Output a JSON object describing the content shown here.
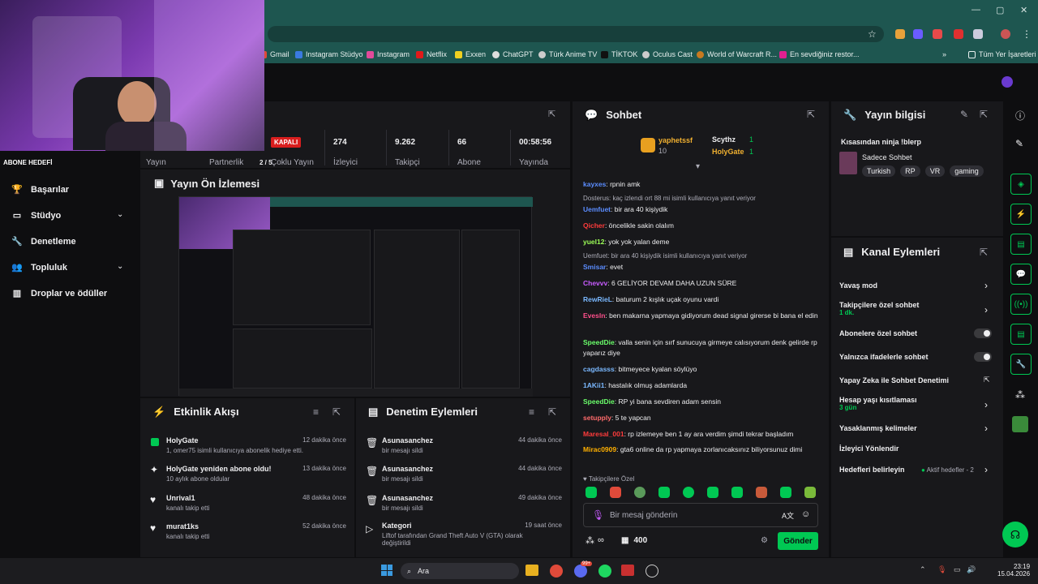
{
  "browser": {
    "bookmarks": [
      "Gmail",
      "Instagram Stüdyo",
      "Instagram",
      "Netflix",
      "Exxen",
      "ChatGPT",
      "Türk Anime TV",
      "TİKTOK",
      "Oculus Cast",
      "World of Warcraft R...",
      "En sevdiğiniz restor...",
      "»",
      "Tüm Yer İşaretleri"
    ],
    "win_min": "—",
    "win_max": "▢",
    "win_close": "✕"
  },
  "webcam": {
    "overlay": "ABONE HEDEFİ",
    "progress": 0.75
  },
  "stats": {
    "yayin": "Yayın",
    "partnerlik": "Partnerlik",
    "partnerlik_val": "2 / 5",
    "coklu": "Çoklu Yayın",
    "kapali": "KAPALI",
    "izleyici_val": "274",
    "izleyici": "İzleyici",
    "takipci_val": "9.262",
    "takipci": "Takipçi",
    "abone_val": "66",
    "abone": "Abone",
    "sure_val": "00:58:56",
    "sure": "Yayında"
  },
  "sidebar": {
    "items": [
      {
        "label": "Başarılar",
        "icon": "trophy-icon"
      },
      {
        "label": "Stüdyo",
        "icon": "studio-icon"
      },
      {
        "label": "Denetleme",
        "icon": "wrench-icon"
      },
      {
        "label": "Topluluk",
        "icon": "community-icon"
      },
      {
        "label": "Droplar ve ödüller",
        "icon": "drops-icon"
      }
    ]
  },
  "preview": {
    "title": "Yayın Ön İzlemesi"
  },
  "activity": {
    "title": "Etkinlik Akışı",
    "events": [
      {
        "title": "HolyGate",
        "sub": "1, omer75 isimli kullanıcıya abonelik hediye etti.",
        "time": "12 dakika önce"
      },
      {
        "title": "HolyGate yeniden abone oldu!",
        "sub": "10 aylık abone oldular",
        "time": "13 dakika önce"
      },
      {
        "title": "Unrival1",
        "sub": "kanalı takip etti",
        "time": "48 dakika önce"
      },
      {
        "title": "murat1ks",
        "sub": "kanalı takip etti",
        "time": "52 dakika önce"
      }
    ]
  },
  "moderation": {
    "title": "Denetim Eylemleri",
    "events": [
      {
        "title": "Asunasanchez",
        "sub": "bir mesajı sildi",
        "time": "44 dakika önce"
      },
      {
        "title": "Asunasanchez",
        "sub": "bir mesajı sildi",
        "time": "44 dakika önce"
      },
      {
        "title": "Asunasanchez",
        "sub": "bir mesajı sildi",
        "time": "49 dakika önce"
      },
      {
        "title": "Kategori",
        "sub": "Liftof tarafından Grand Theft Auto V (GTA) olarak değiştirildi",
        "time": "19 saat önce"
      }
    ]
  },
  "chat": {
    "title": "Sohbet",
    "leader1": "yaphetssf",
    "leader1_count": "10",
    "leader2": "Scythz",
    "leader2_count": "1",
    "leader3": "HolyGate",
    "leader3_count": "1",
    "messages": [
      {
        "user": "kayxes",
        "color": "#5b8dff",
        "text": ": rpnin amk"
      },
      {
        "reply": "Dosterus: kaç izlendi ort 88 mi isimli kullanıcıya yanıt veriyor"
      },
      {
        "user": "Uemfuet",
        "color": "#5b8dff",
        "text": ": bir ara 40 kişiydik"
      },
      {
        "user": "Qicher",
        "color": "#ff3b3b",
        "text": ": öncelikle sakin olalım"
      },
      {
        "user": "yuel12",
        "color": "#9cff57",
        "text": ": yok yok yalan deme"
      },
      {
        "reply": "Uemfuet: bir ara 40 kişiydik isimli kullanıcıya yanıt veriyor"
      },
      {
        "user": "Smisar",
        "color": "#5b8dff",
        "text": ": evet"
      },
      {
        "user": "Chevvv",
        "color": "#c85cff",
        "text": ": 6 GELİYOR DEVAM DAHA UZUN SÜRE"
      },
      {
        "user": "RewRieL",
        "color": "#7ab8ff",
        "text": ": baturum 2 kışlık uçak oyunu vardi"
      },
      {
        "user": "Evesln",
        "color": "#ff4f8b",
        "text": ": ben makarna yapmaya gidiyorum dead signal girerse bi bana el edin"
      },
      {
        "user": "SpeedDie",
        "color": "#6bff6b",
        "text": ": valla senin için sırf sunucuya girmeye calısıyorum denk gelirde rp yaparız diye"
      },
      {
        "user": "cagdasss",
        "color": "#7ab8ff",
        "text": ": bitmeyece kyalan söylüyo"
      },
      {
        "user": "1AKii1",
        "color": "#7ab8ff",
        "text": ": hastalık olmuş adamlarda"
      },
      {
        "user": "SpeedDie",
        "color": "#6bff6b",
        "text": ": RP yi bana sevdiren adam sensin"
      },
      {
        "user": "setupply",
        "color": "#ff6b6b",
        "text": ": 5 te yapcan"
      },
      {
        "user": "Maresal_001",
        "color": "#ff3b3b",
        "text": ": rp izlemeye ben 1 ay ara verdim şimdi tekrar başladım"
      },
      {
        "user": "Mirac0909",
        "color": "#ffb000",
        "text": ": gta6 online da rp yapmaya zorlanıcaksınız biliyorsunuz dimi"
      }
    ],
    "follower_only": "Takipçilere Özel",
    "placeholder": "Bir mesaj gönderin",
    "points": "400",
    "infinity": "∞",
    "send": "Gönder"
  },
  "streaminfo": {
    "title": "Yayın bilgisi",
    "stream_title": "Kısasından ninja !blerp",
    "category": "Sadece Sohbet",
    "tags": [
      "Turkish",
      "RP",
      "VR",
      "gaming"
    ]
  },
  "channel": {
    "title": "Kanal Eylemleri",
    "rows": [
      {
        "label": "Yavaş mod",
        "sub": ""
      },
      {
        "label": "Takipçilere özel sohbet",
        "sub": "1 dk."
      },
      {
        "label": "Abonelere özel sohbet",
        "sub": ""
      },
      {
        "label": "Yalnızca ifadelerle sohbet",
        "sub": ""
      },
      {
        "label": "Yapay Zeka ile Sohbet Denetimi",
        "sub": ""
      },
      {
        "label": "Hesap yaşı kısıtlaması",
        "sub": "3 gün"
      },
      {
        "label": "Yasaklanmış kelimeler",
        "sub": ""
      },
      {
        "label": "İzleyici Yönlendir",
        "sub": ""
      },
      {
        "label": "Hedefleri belirleyin",
        "sub": "Aktif hedefler - 2"
      }
    ]
  },
  "taskbar": {
    "search": "Ara",
    "time": "23:19",
    "date": "15.04.2026",
    "badge": "99+"
  },
  "colors": {
    "accent": "#00c853",
    "panel": "#18181b",
    "bg": "#0e0e10"
  }
}
